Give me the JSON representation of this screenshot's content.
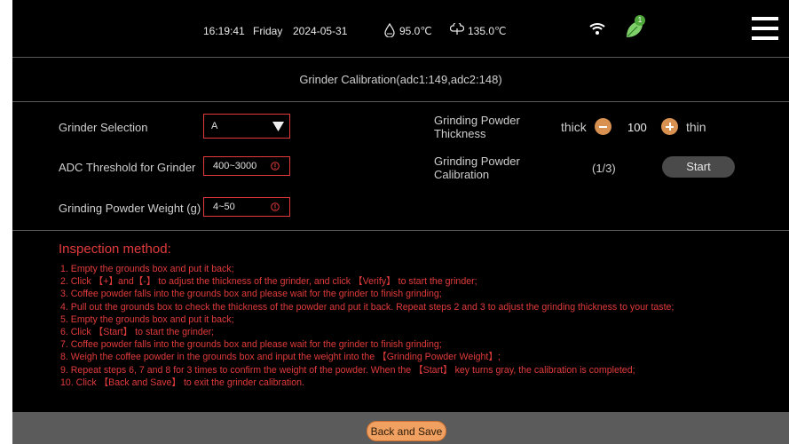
{
  "status": {
    "time": "16:19:41",
    "day": "Friday",
    "date": "2024-05-31",
    "temp1": "95.0℃",
    "temp2": "135.0℃",
    "badge": "1"
  },
  "page_title": "Grinder Calibration(adc1:149,adc2:148)",
  "form": {
    "grinder_selection_label": "Grinder Selection",
    "grinder_selection_value": "A",
    "adc_label": "ADC Threshold for Grinder",
    "adc_placeholder": "400~3000",
    "weight_label": "Grinding Powder Weight (g)",
    "weight_placeholder": "4~50",
    "thickness_label_1": "Grinding Powder",
    "thickness_label_2": "Thickness",
    "thick": "thick",
    "thin": "thin",
    "thickness_value": "100",
    "calib_label_1": "Grinding Powder",
    "calib_label_2": "Calibration",
    "calib_progress": "(1/3)",
    "start": "Start"
  },
  "inspection": {
    "title": "Inspection method:",
    "steps": [
      "1. Empty the grounds box and put it back;",
      "2. Click 【+】and【-】 to adjust the thickness of the grinder, and click 【Verify】 to start the grinder;",
      "3. Coffee powder falls into the grounds box and please wait for the grinder to finish grinding;",
      "4. Pull out the grounds box to check the thickness of the powder and put it back. Repeat steps 2 and 3 to adjust the grinding thickness to your taste;",
      "5. Empty the grounds box and put it back;",
      "6. Click 【Start】 to start the grinder;",
      "7. Coffee powder falls into the grounds box and please wait for the grinder to finish grinding;",
      "8. Weigh the coffee powder in the grounds box and input the weight into the 【Grinding Powder Weight】;",
      "9. Repeat steps 6, 7 and 8 for 3 times to confirm the weight of the powder. When the 【Start】 key turns gray, the calibration is completed;",
      "10. Click 【Back and Save】 to exit the grinder calibration."
    ]
  },
  "footer": {
    "back_save": "Back and Save"
  },
  "colors": {
    "accent": "#d89150",
    "error": "#e23b3b",
    "button_orange": "#f0a060"
  }
}
